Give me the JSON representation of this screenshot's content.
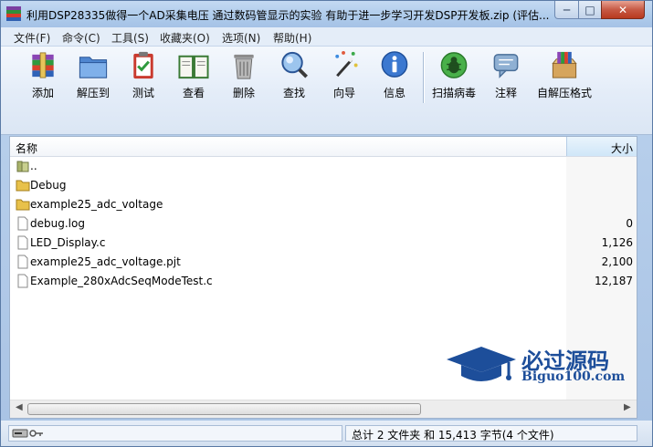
{
  "window": {
    "title": "利用DSP28335做得一个AD采集电压 通过数码管显示的实验 有助于进一步学习开发DSP开发板.zip (评估..."
  },
  "menu": [
    "文件(F)",
    "命令(C)",
    "工具(S)",
    "收藏夹(O)",
    "选项(N)",
    "帮助(H)"
  ],
  "toolbar": {
    "add": "添加",
    "extract": "解压到",
    "test": "测试",
    "view": "查看",
    "delete": "删除",
    "find": "查找",
    "wizard": "向导",
    "info": "信息",
    "virus_scan": "扫描病毒",
    "comment": "注释",
    "sfx": "自解压格式"
  },
  "list": {
    "col_name": "名称",
    "col_size": "大小",
    "rows": [
      {
        "name": "..",
        "size": "",
        "icon": "up-folder"
      },
      {
        "name": "Debug",
        "size": "",
        "icon": "folder"
      },
      {
        "name": "example25_adc_voltage",
        "size": "",
        "icon": "folder"
      },
      {
        "name": "debug.log",
        "size": "0",
        "icon": "file"
      },
      {
        "name": "LED_Display.c",
        "size": "1,126",
        "icon": "file"
      },
      {
        "name": "example25_adc_voltage.pjt",
        "size": "2,100",
        "icon": "file"
      },
      {
        "name": "Example_280xAdcSeqModeTest.c",
        "size": "12,187",
        "icon": "file"
      }
    ]
  },
  "watermark": {
    "title": "必过源码",
    "subtitle": "Biguo100.com"
  },
  "status": {
    "summary": "总计 2 文件夹 和 15,413 字节(4 个文件)"
  },
  "colors": {
    "accent": "#1d4e9a",
    "close": "#c75a45"
  }
}
